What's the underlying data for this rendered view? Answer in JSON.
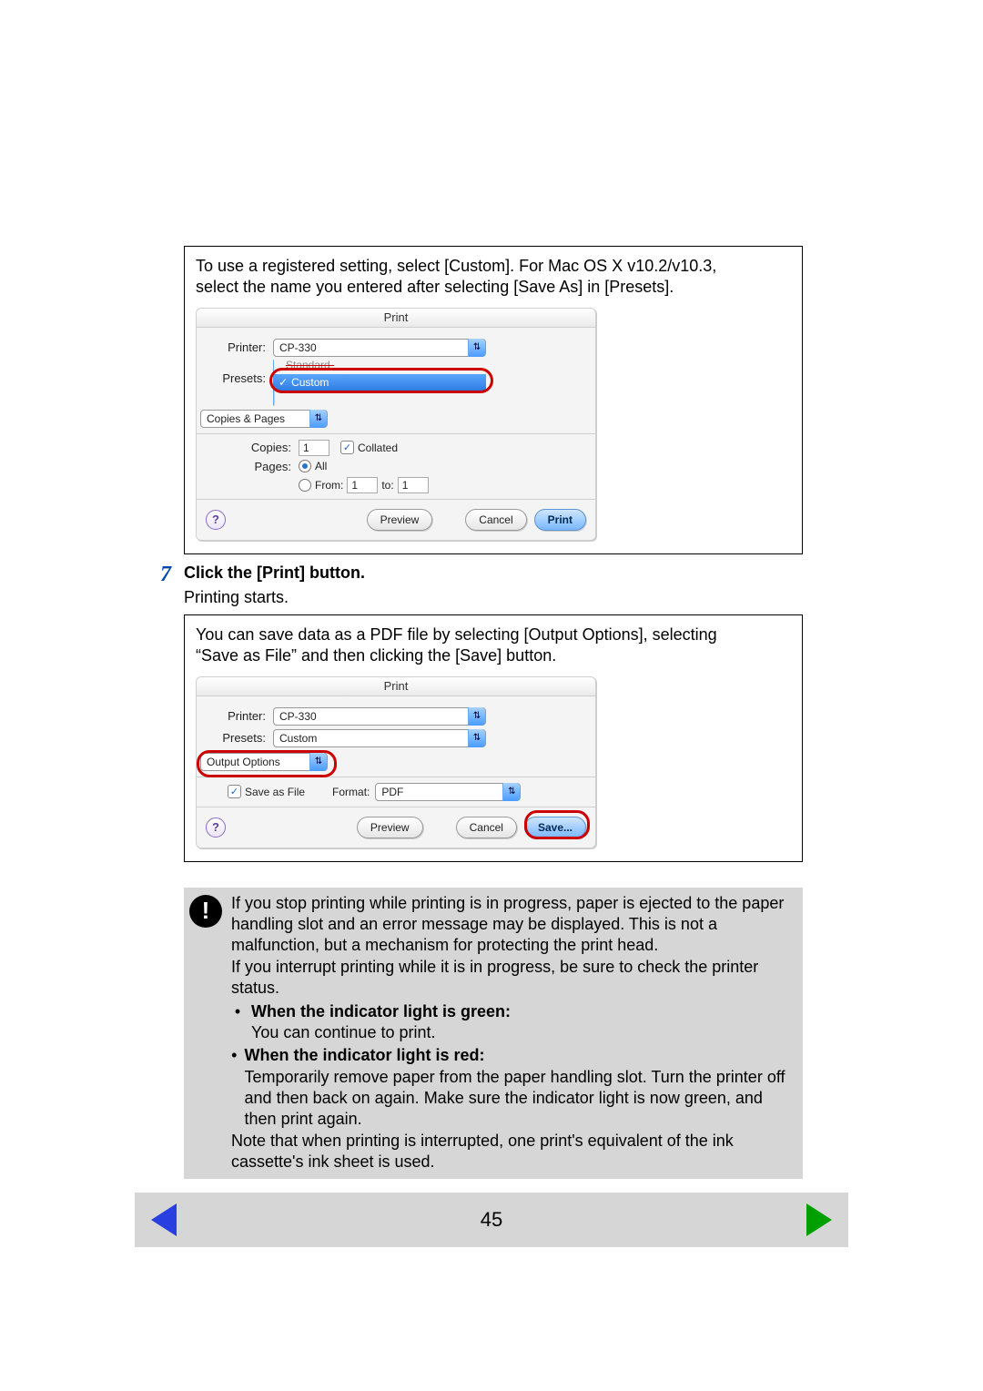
{
  "intro": {
    "line1": "To use a registered setting, select [Custom]. For Mac OS X v10.2/v10.3,",
    "line2": "select the name you entered after selecting [Save As] in [Presets]."
  },
  "dialog1": {
    "title": "Print",
    "printer_label": "Printer:",
    "printer_value": "CP-330",
    "presets_label": "Presets:",
    "presets_strike": "Standard",
    "presets_selected": "Custom",
    "pane": "Copies & Pages",
    "copies_label": "Copies:",
    "copies_value": "1",
    "collated_label": "Collated",
    "pages_label": "Pages:",
    "all_label": "All",
    "from_label": "From:",
    "from_value": "1",
    "to_label": "to:",
    "to_value": "1",
    "preview": "Preview",
    "cancel": "Cancel",
    "print": "Print"
  },
  "step7": {
    "num": "7",
    "title": "Click the [Print] button.",
    "sub": "Printing starts."
  },
  "pdfbox": {
    "line1": "You can save data as a PDF file by selecting [Output Options], selecting",
    "line2": "“Save as File” and then clicking the [Save] button."
  },
  "dialog2": {
    "title": "Print",
    "printer_label": "Printer:",
    "printer_value": "CP-330",
    "presets_label": "Presets:",
    "presets_value": "Custom",
    "pane": "Output Options",
    "saveasfile_label": "Save as File",
    "format_label": "Format:",
    "format_value": "PDF",
    "preview": "Preview",
    "cancel": "Cancel",
    "save": "Save..."
  },
  "note": {
    "p1": "If you stop printing while printing is in progress, paper is ejected to the paper handling slot and an error message may be displayed. This is not a malfunction, but a mechanism for protecting the print head.",
    "p2": "If you interrupt printing while it is in progress, be sure to check the printer status.",
    "green_title": "When the indicator light is green:",
    "green_body": "You can continue to print.",
    "red_title": "When the indicator light is red:",
    "red_body": "Temporarily remove paper from the paper handling slot. Turn the printer off and then back on again. Make sure the indicator light is now green, and then print again.",
    "p3": "Note that when printing is interrupted, one print's equivalent of the ink cassette's ink sheet is used."
  },
  "footer": {
    "page": "45"
  }
}
